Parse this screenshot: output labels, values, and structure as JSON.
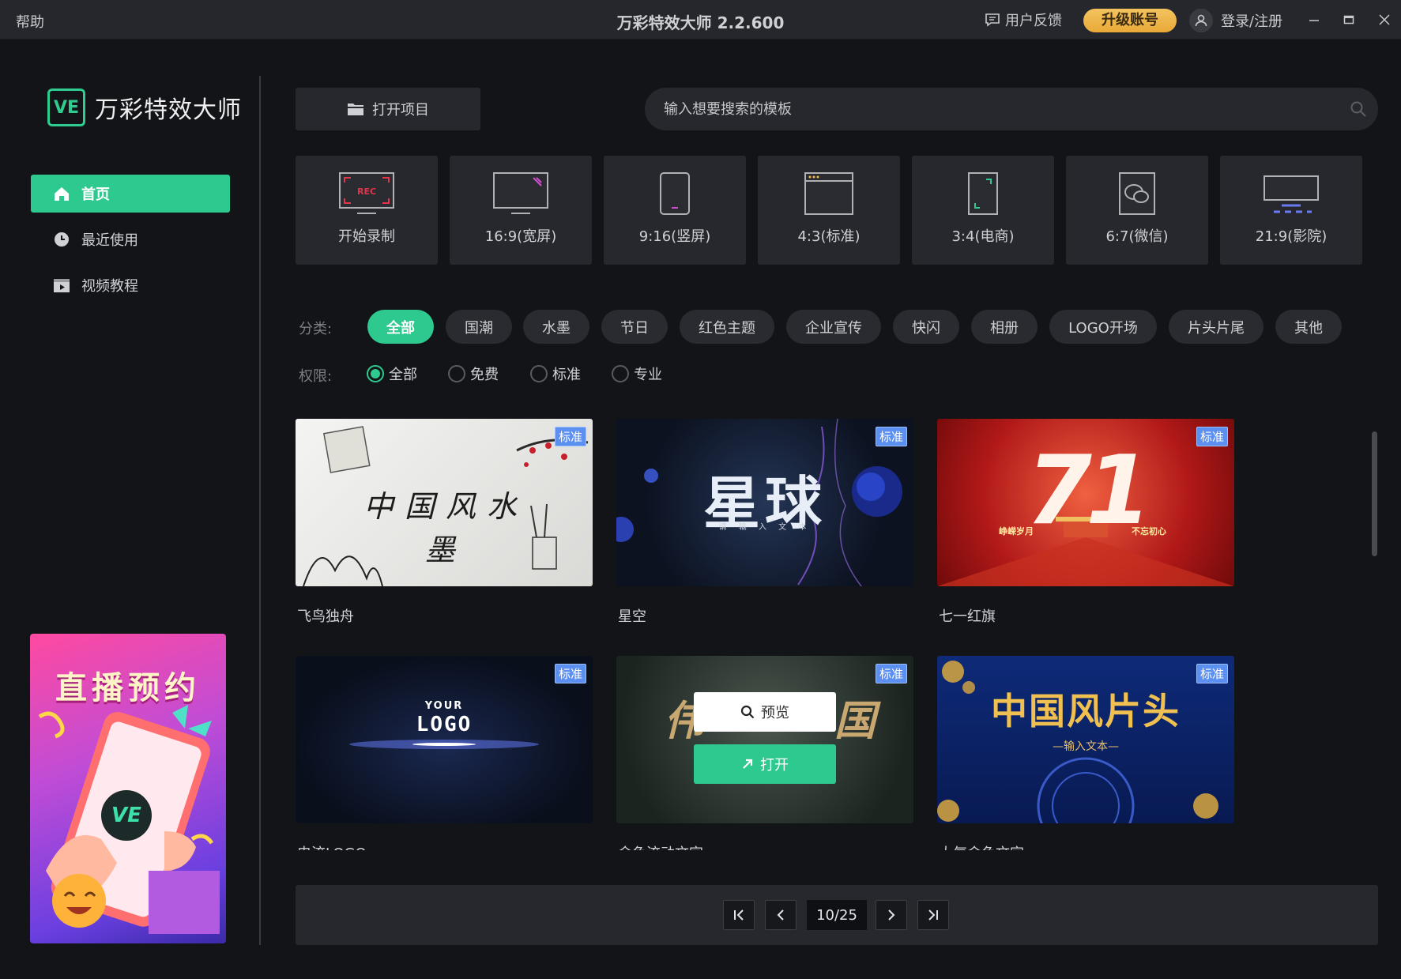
{
  "titlebar": {
    "help": "帮助",
    "title": "万彩特效大师 2.2.600",
    "feedback": "用户反馈",
    "upgrade": "升级账号",
    "login": "登录/注册"
  },
  "sidebar": {
    "logo_mark": "VE",
    "logo_text": "万彩特效大师",
    "items": [
      {
        "label": "首页",
        "icon": "home-icon",
        "active": true
      },
      {
        "label": "最近使用",
        "icon": "clock-icon",
        "active": false
      },
      {
        "label": "视频教程",
        "icon": "video-tutorial-icon",
        "active": false
      }
    ],
    "promo_title": "直播预约",
    "promo_badge": "VE"
  },
  "toolbar": {
    "open_project": "打开项目",
    "search_placeholder": "输入想要搜索的模板"
  },
  "ratios": [
    {
      "label": "开始录制",
      "icon": "record-icon",
      "rec": "REC"
    },
    {
      "label": "16:9(宽屏)",
      "icon": "widescreen-icon"
    },
    {
      "label": "9:16(竖屏)",
      "icon": "portrait-icon"
    },
    {
      "label": "4:3(标准)",
      "icon": "standard-icon"
    },
    {
      "label": "3:4(电商)",
      "icon": "ecommerce-icon"
    },
    {
      "label": "6:7(微信)",
      "icon": "wechat-icon"
    },
    {
      "label": "21:9(影院)",
      "icon": "cinema-icon"
    }
  ],
  "filters": {
    "category_label": "分类:",
    "categories": [
      "全部",
      "国潮",
      "水墨",
      "节日",
      "红色主题",
      "企业宣传",
      "快闪",
      "相册",
      "LOGO开场",
      "片头片尾",
      "其他"
    ],
    "active_category": "全部",
    "permission_label": "权限:",
    "permissions": [
      "全部",
      "免费",
      "标准",
      "专业"
    ],
    "active_permission": "全部"
  },
  "templates": [
    {
      "name": "飞鸟独舟",
      "badge": "标准",
      "overlay_text": "中国风水墨"
    },
    {
      "name": "星空",
      "badge": "标准",
      "overlay_text": "星球",
      "sub_text": "请 输 入 文 本"
    },
    {
      "name": "七一红旗",
      "badge": "标准",
      "overlay_text": "71",
      "left_caption": "峥嵘岁月",
      "right_caption": "不忘初心"
    },
    {
      "name": "电流LOGO",
      "badge": "标准",
      "overlay_text": "LOGO",
      "top_text": "YOUR"
    },
    {
      "name": "金色流动文字",
      "badge": "标准",
      "overlay_text": "伟",
      "overlay_text_right": "国",
      "preview": "预览",
      "open": "打开"
    },
    {
      "name": "大气金色文字",
      "badge": "标准",
      "overlay_text": "中国风片头",
      "sub_text": "—输入文本—"
    }
  ],
  "pagination": {
    "current": "10/25"
  },
  "colors": {
    "accent": "#2ec98e",
    "upgrade": "#f0b94a",
    "badge": "#5b8ff0",
    "background": "#131418",
    "panel": "#27282d"
  }
}
